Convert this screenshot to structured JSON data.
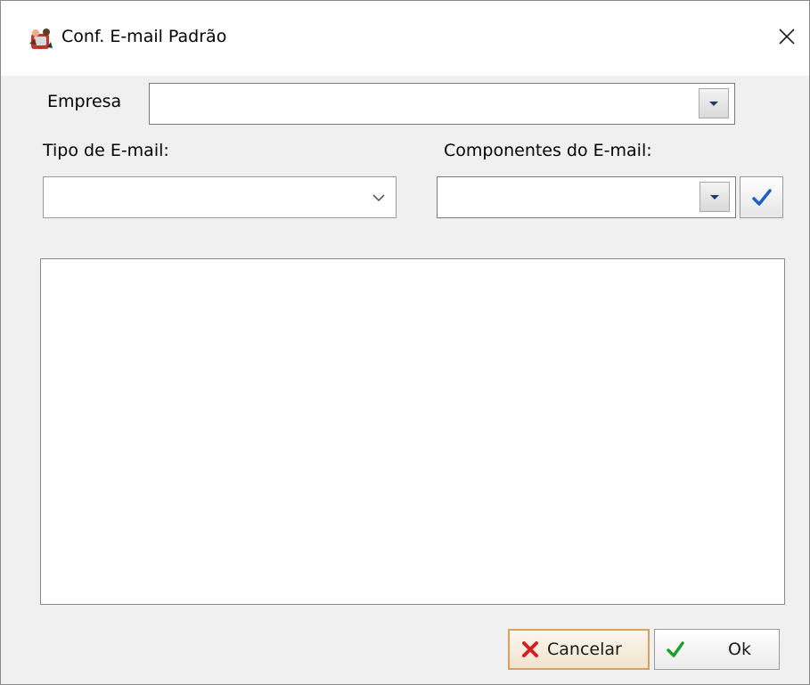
{
  "window": {
    "title": "Conf. E-mail Padrão",
    "title_icon": "app-icon",
    "close_icon": "close-icon"
  },
  "form": {
    "empresa": {
      "label": "Empresa",
      "value": ""
    },
    "tipo_email": {
      "label": "Tipo de E-mail:",
      "value": ""
    },
    "componentes_email": {
      "label": "Componentes do E-mail:",
      "value": ""
    },
    "body_text": ""
  },
  "buttons": {
    "cancel": {
      "label": "Cancelar",
      "icon": "x-icon",
      "icon_color": "#d42020"
    },
    "ok": {
      "label": "Ok",
      "icon": "checkmark-icon",
      "icon_color": "#1e9e2a"
    }
  },
  "colors": {
    "window_bg": "#f0f0f0",
    "cancel_border": "#d7a25a",
    "check_blue": "#1c5fc7"
  }
}
